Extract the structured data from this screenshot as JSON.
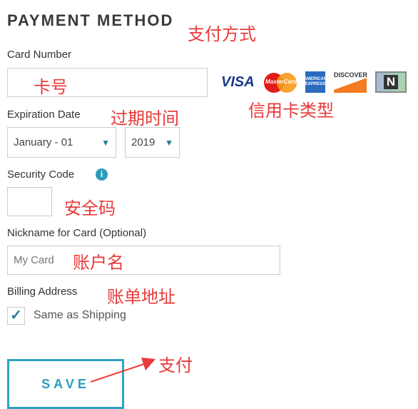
{
  "title": "PAYMENT METHOD",
  "card_number": {
    "label": "Card Number",
    "value": ""
  },
  "card_types": [
    "VISA",
    "MasterCard",
    "American Express",
    "DISCOVER",
    "N"
  ],
  "expiration": {
    "label": "Expiration Date",
    "month": "January - 01",
    "year": "2019"
  },
  "security": {
    "label": "Security Code",
    "value": ""
  },
  "nickname": {
    "label": "Nickname for Card (Optional)",
    "placeholder": "My Card"
  },
  "billing": {
    "label": "Billing Address",
    "same_as_shipping": "Same as Shipping",
    "checked": true
  },
  "save_label": "SAVE",
  "annotations": {
    "title": "支付方式",
    "card_number": "卡号",
    "card_types": "信用卡类型",
    "expiration": "过期时间",
    "security": "安全码",
    "nickname": "账户名",
    "billing": "账单地址",
    "save": "支付"
  },
  "colors": {
    "accent": "#2ba3c1",
    "annotation": "#e83a3a"
  }
}
